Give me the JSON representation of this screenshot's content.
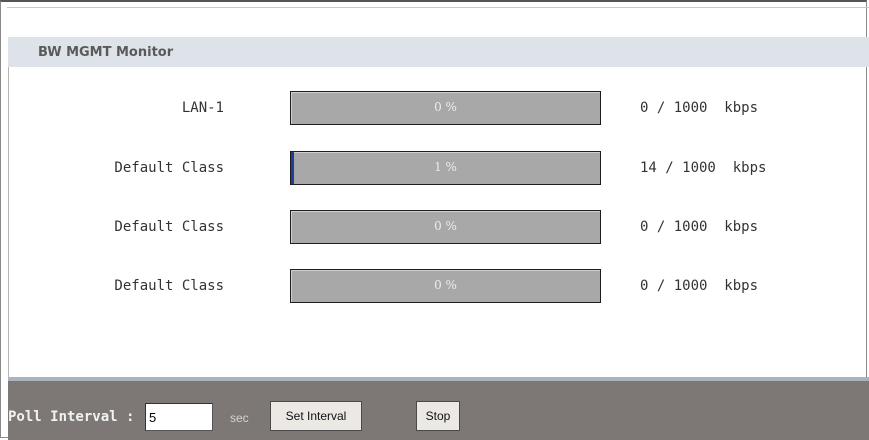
{
  "section": {
    "title": "BW MGMT Monitor"
  },
  "rows": [
    {
      "label": "LAN-1",
      "percent_text": "0 %",
      "fill_fraction": 0.0,
      "rate": "0 / 1000  kbps"
    },
    {
      "label": "Default Class",
      "percent_text": "1 %",
      "fill_fraction": 0.01,
      "rate": "14 / 1000  kbps"
    },
    {
      "label": "Default Class",
      "percent_text": "0 %",
      "fill_fraction": 0.0,
      "rate": "0 / 1000  kbps"
    },
    {
      "label": "Default Class",
      "percent_text": "0 %",
      "fill_fraction": 0.0,
      "rate": "0 / 1000  kbps"
    }
  ],
  "footer": {
    "poll_label": "Poll Interval :",
    "poll_value": "5",
    "unit": "sec",
    "set_interval_label": "Set Interval",
    "stop_label": "Stop"
  },
  "colors": {
    "header_bg": "#dde3e8",
    "bar_bg": "#a8a8a8",
    "bar_fill": "#1d3f9a",
    "footer_bg": "#7d7876"
  }
}
